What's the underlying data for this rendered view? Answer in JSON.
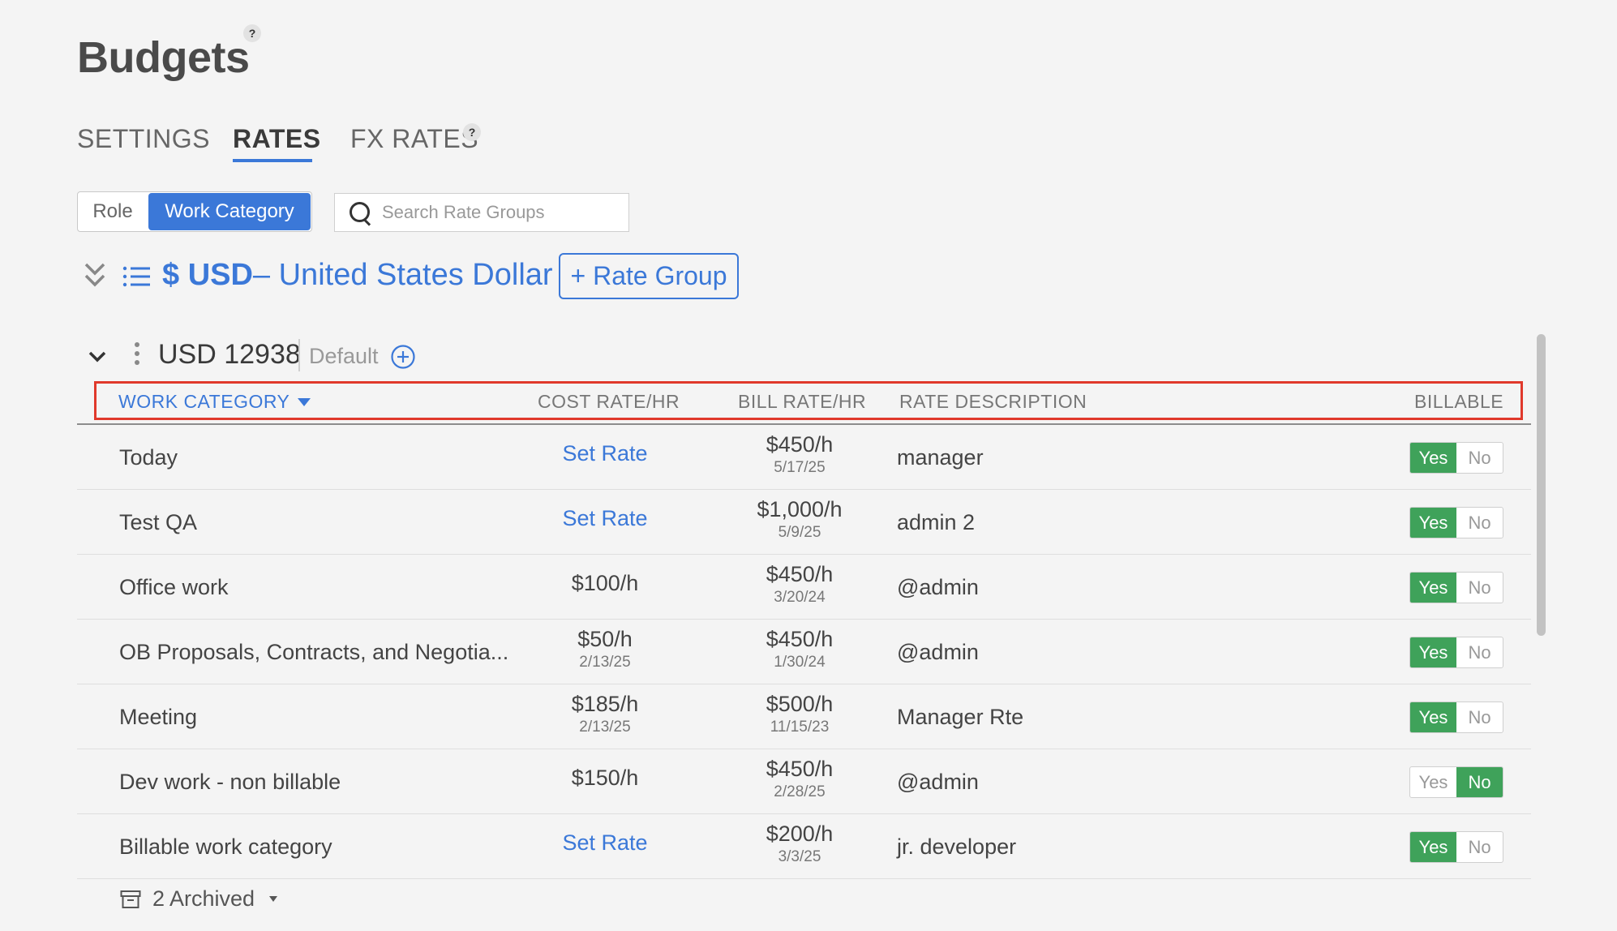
{
  "page": {
    "title": "Budgets",
    "help": "?"
  },
  "tabs": [
    {
      "label": "SETTINGS"
    },
    {
      "label": "RATES"
    },
    {
      "label": "FX RATES"
    }
  ],
  "toggle": {
    "role": "Role",
    "work_category": "Work Category",
    "selected": "Work Category"
  },
  "search": {
    "placeholder": "Search Rate Groups",
    "value": ""
  },
  "currency": {
    "code": "$ USD",
    "name": "– United States Dollar",
    "add_button": "+ Rate Group"
  },
  "group": {
    "name": "USD 12938",
    "default_label": "Default"
  },
  "table": {
    "headers": {
      "work_category": "WORK CATEGORY",
      "cost_rate": "COST RATE/HR",
      "bill_rate": "BILL RATE/HR",
      "rate_description": "RATE DESCRIPTION",
      "billable": "BILLABLE"
    },
    "yes_label": "Yes",
    "no_label": "No",
    "rows": [
      {
        "name": "Today",
        "cost": "Set Rate",
        "cost_date": "",
        "bill": "$450/h",
        "bill_date": "5/17/25",
        "desc": "manager",
        "billable": true
      },
      {
        "name": "Test QA",
        "cost": "Set Rate",
        "cost_date": "",
        "bill": "$1,000/h",
        "bill_date": "5/9/25",
        "desc": "admin 2",
        "billable": true
      },
      {
        "name": "Office work",
        "cost": "$100/h",
        "cost_date": "",
        "bill": "$450/h",
        "bill_date": "3/20/24",
        "desc": "@admin",
        "billable": true
      },
      {
        "name": "OB Proposals, Contracts, and Negotia...",
        "cost": "$50/h",
        "cost_date": "2/13/25",
        "bill": "$450/h",
        "bill_date": "1/30/24",
        "desc": "@admin",
        "billable": true
      },
      {
        "name": "Meeting",
        "cost": "$185/h",
        "cost_date": "2/13/25",
        "bill": "$500/h",
        "bill_date": "11/15/23",
        "desc": "Manager Rte",
        "billable": true
      },
      {
        "name": "Dev work - non billable",
        "cost": "$150/h",
        "cost_date": "",
        "bill": "$450/h",
        "bill_date": "2/28/25",
        "desc": "@admin",
        "billable": false
      },
      {
        "name": "Billable work category",
        "cost": "Set Rate",
        "cost_date": "",
        "bill": "$200/h",
        "bill_date": "3/3/25",
        "desc": "jr. developer",
        "billable": true
      }
    ]
  },
  "archived": {
    "label": "2 Archived"
  },
  "colors": {
    "accent": "#3b78d8",
    "billable_on": "#3fa25a",
    "highlight_border": "#e0392b"
  }
}
